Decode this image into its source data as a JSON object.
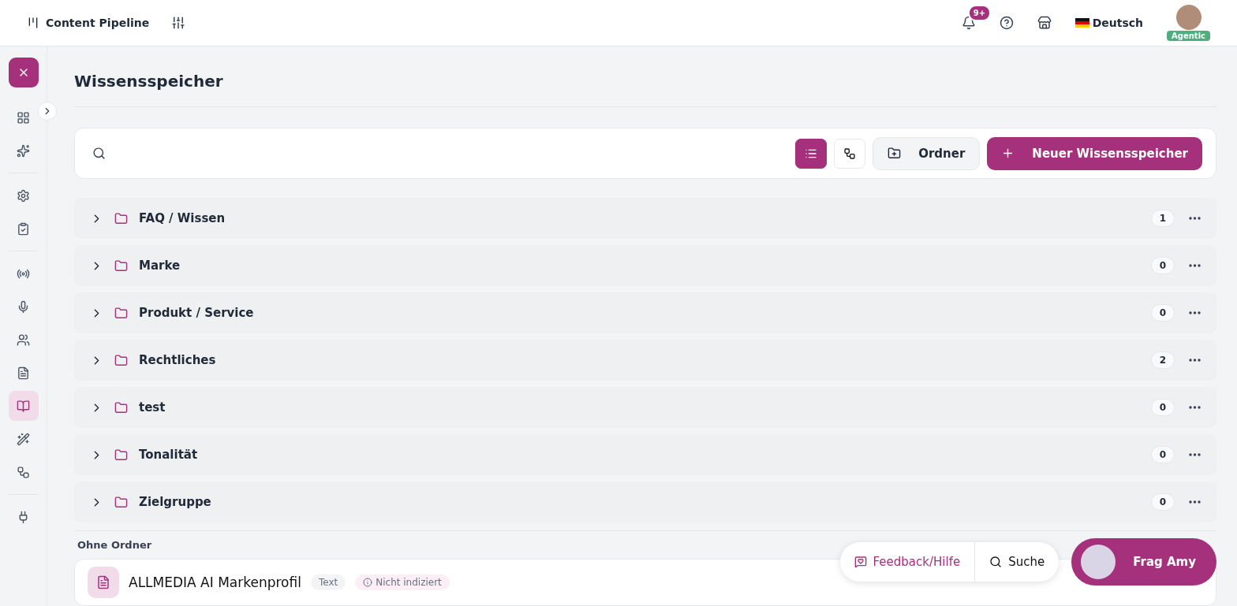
{
  "topbar": {
    "title": "Content Pipeline",
    "notifications": "9+",
    "language": "Deutsch",
    "user_badge": "Agentic"
  },
  "sidebar": {
    "groups": [
      {
        "items": [
          {
            "selected": false
          },
          {
            "selected": false
          }
        ]
      },
      {
        "items": [
          {
            "selected": false
          },
          {
            "selected": false
          }
        ]
      },
      {
        "items": [
          {
            "selected": false
          },
          {
            "selected": false
          },
          {
            "selected": false
          },
          {
            "selected": false
          },
          {
            "selected": true
          },
          {
            "selected": false
          },
          {
            "selected": false
          }
        ]
      },
      {
        "items": [
          {
            "selected": false
          }
        ]
      }
    ]
  },
  "page": {
    "title": "Wissensspeicher"
  },
  "toolbar": {
    "view_toggle": [
      {
        "selected": true
      },
      {
        "selected": false
      }
    ],
    "folder_button": "Ordner",
    "new_button": "Neuer Wissensspeicher"
  },
  "folders": [
    {
      "name": "FAQ / Wissen",
      "count": "1",
      "expanded": false
    },
    {
      "name": "Marke",
      "count": "0",
      "expanded": false
    },
    {
      "name": "Produkt / Service",
      "count": "0",
      "expanded": false
    },
    {
      "name": "Rechtliches",
      "count": "2",
      "expanded": false
    },
    {
      "name": "test",
      "count": "0",
      "expanded": false
    },
    {
      "name": "Tonalität",
      "count": "0",
      "expanded": false
    },
    {
      "name": "Zielgruppe",
      "count": "0",
      "expanded": false
    }
  ],
  "unfiled": {
    "heading": "Ohne Ordner",
    "items": [
      {
        "title": "ALLMEDIA AI Markenprofil",
        "type": "Text",
        "status": "Nicht indiziert"
      }
    ]
  },
  "floating": {
    "feedback": "Feedback/Hilfe",
    "search": "Suche",
    "assistant": "Frag Amy"
  }
}
